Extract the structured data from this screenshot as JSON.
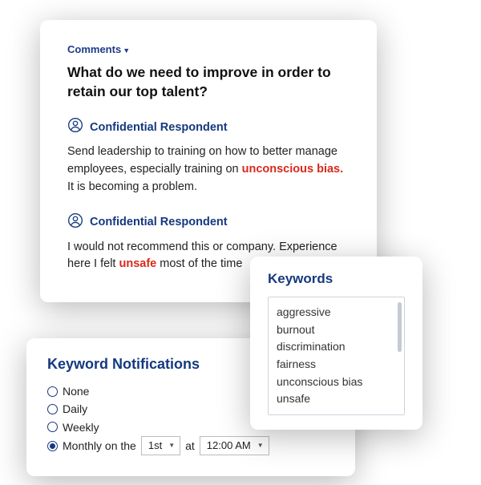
{
  "comments": {
    "link_label": "Comments",
    "question": "What do we need to improve in order to retain our top talent?",
    "respondent_label": "Confidential Respondent",
    "responses": [
      {
        "pre": "Send leadership to training on how to better manage employees, especially training on ",
        "kw": "unconscious bias.",
        "post": " It is becoming a problem."
      },
      {
        "pre": "I would not recommend this or company. Experience here I felt ",
        "kw": "unsafe",
        "post": " most of the time"
      }
    ]
  },
  "keywords": {
    "title": "Keywords",
    "items": [
      "aggressive",
      "burnout",
      "discrimination",
      "fairness",
      "unconscious bias",
      "unsafe"
    ]
  },
  "notifications": {
    "title": "Keyword Notifications",
    "options": {
      "none": "None",
      "daily": "Daily",
      "weekly": "Weekly",
      "monthly_prefix": "Monthly on the",
      "at_label": "at"
    },
    "selected": "monthly",
    "day_value": "1st",
    "time_value": "12:00 AM"
  }
}
